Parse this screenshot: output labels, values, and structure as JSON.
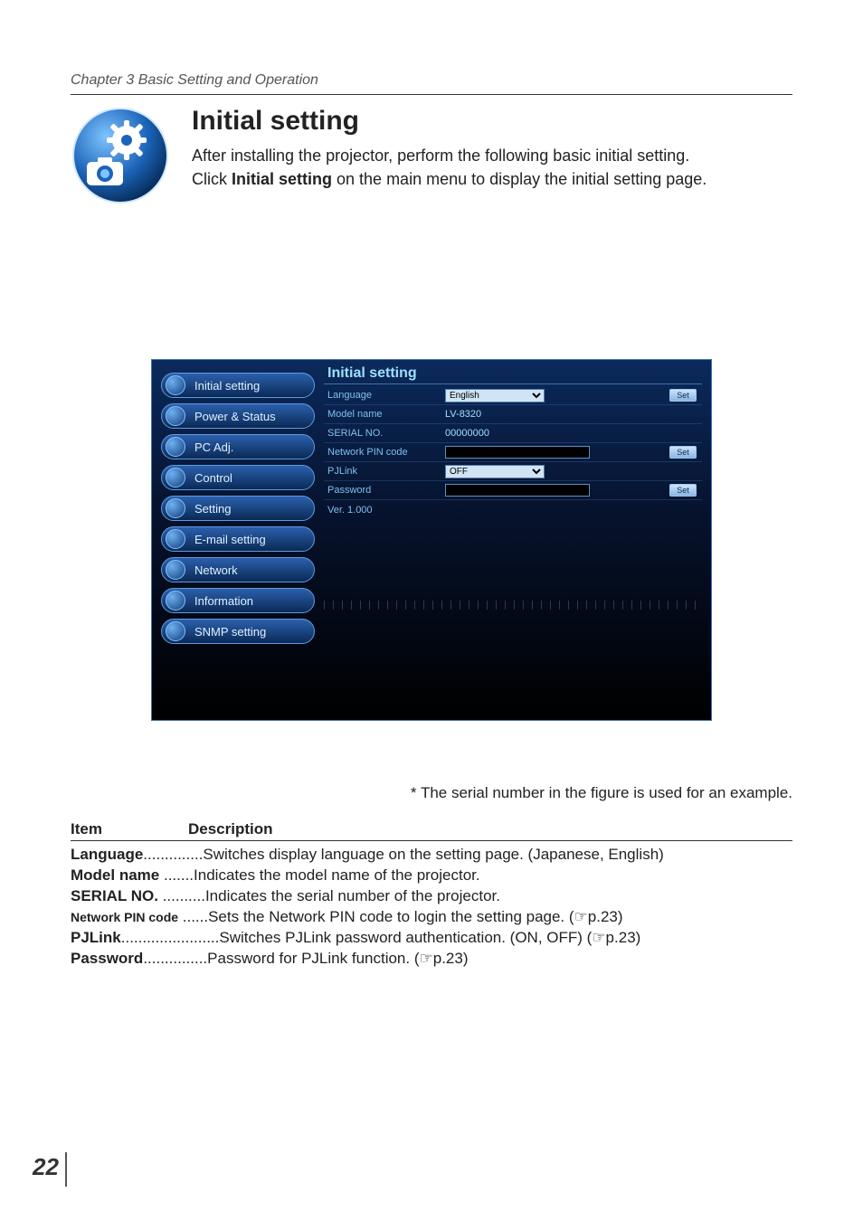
{
  "chapter_header": "Chapter 3 Basic Setting and Operation",
  "page_title": "Initial setting",
  "intro_line1": "After installing the projector, perform the following basic initial setting.",
  "intro_line2a": "Click ",
  "intro_line2_bold": "Initial setting",
  "intro_line2b": " on the main menu to display the initial setting page.",
  "sidebar": {
    "items": [
      "Initial setting",
      "Power & Status",
      "PC Adj.",
      "Control",
      "Setting",
      "E-mail setting",
      "Network",
      "Information",
      "SNMP setting"
    ]
  },
  "panel": {
    "title": "Initial setting",
    "language_label": "Language",
    "language_value": "English",
    "model_label": "Model name",
    "model_value": "LV-8320",
    "serial_label": "SERIAL NO.",
    "serial_value": "00000000",
    "pin_label": "Network PIN code",
    "pin_value": "",
    "pjlink_label": "PJLink",
    "pjlink_value": "OFF",
    "password_label": "Password",
    "password_value": "",
    "version": "Ver. 1.000",
    "set_btn": "Set"
  },
  "footnote": "* The serial number in the figure is used for an example.",
  "table": {
    "col_item": "Item",
    "col_desc": "Description",
    "rows": [
      {
        "item": "Language",
        "dots": "..............",
        "desc": "Switches display language on the setting page. (Japanese, English)"
      },
      {
        "item": "Model name",
        "dots": " .......",
        "desc": "Indicates the model name of the projector."
      },
      {
        "item": "SERIAL NO.",
        "dots": "  ..........",
        "desc": "Indicates the serial number of the projector."
      },
      {
        "item_np": "Network PIN code",
        "dots": " ......",
        "desc": "Sets the Network PIN code to login the setting page. (☞p.23)"
      },
      {
        "item": "PJLink",
        "dots": ".......................",
        "desc": "Switches PJLink password authentication. (ON, OFF) (☞p.23)"
      },
      {
        "item": "Password",
        "dots": "...............",
        "desc": "Password for PJLink function. (☞p.23)"
      }
    ]
  },
  "page_number": "22"
}
